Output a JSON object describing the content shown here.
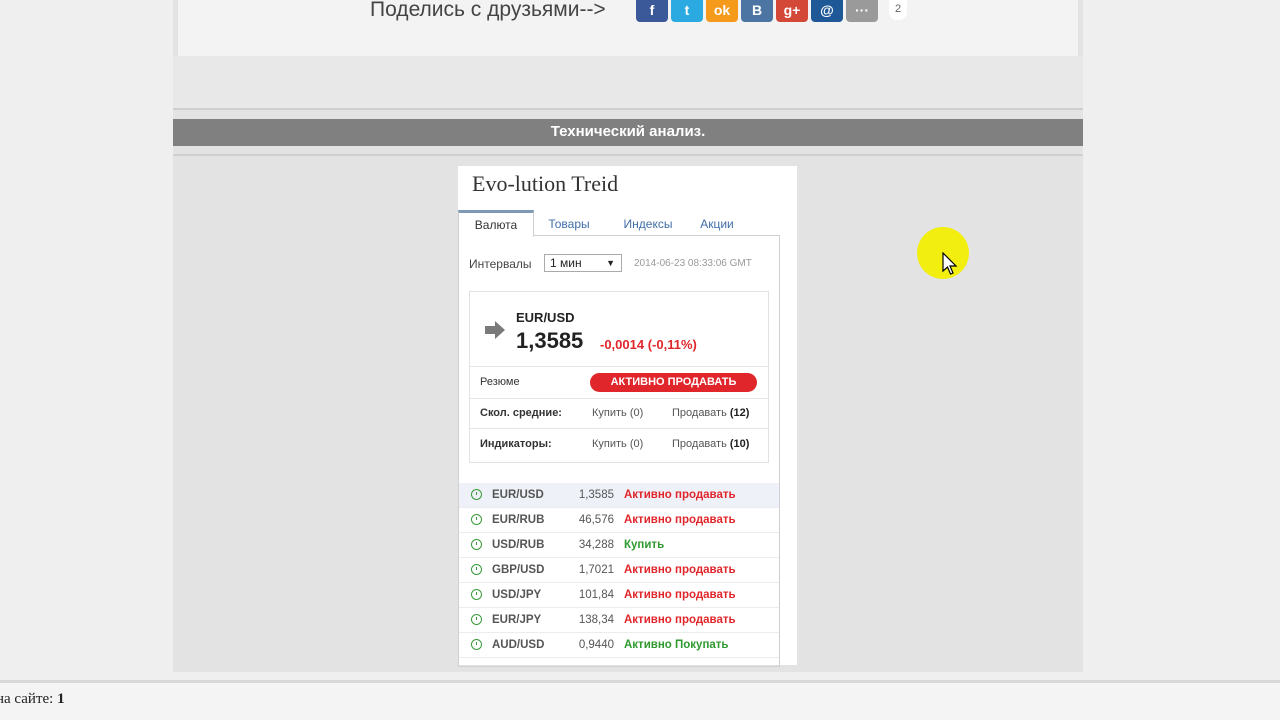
{
  "share": {
    "text": "Поделись с друзьями-->",
    "icons": [
      {
        "icon": "facebook-icon",
        "glyph": "f",
        "color": "#3b5998"
      },
      {
        "icon": "twitter-icon",
        "glyph": "t",
        "color": "#2ba9e1"
      },
      {
        "icon": "odnoklassniki-icon",
        "glyph": "ok",
        "color": "#f59a1a"
      },
      {
        "icon": "vkontakte-icon",
        "glyph": "B",
        "color": "#4c75a3"
      },
      {
        "icon": "google-plus-icon",
        "glyph": "g+",
        "color": "#d34836"
      },
      {
        "icon": "mail-ru-icon",
        "glyph": "@",
        "color": "#1e5896"
      },
      {
        "icon": "more-icon",
        "glyph": "···",
        "color": "#9a9a9a"
      }
    ],
    "count": "2"
  },
  "section": {
    "title": "Технический анализ."
  },
  "widget": {
    "title": "Evo-lution Treid",
    "tabs": [
      "Валюта",
      "Товары",
      "Индексы",
      "Акции"
    ],
    "interval_label": "Интервалы",
    "interval_value": "1 мин",
    "timestamp": "2014-06-23 08:33:06 GMT",
    "summary": {
      "pair": "EUR/USD",
      "price": "1,3585",
      "change": "-0,0014 (-0,11%)",
      "resume_label": "Резюме",
      "resume_badge": "АКТИВНО ПРОДАВАТЬ",
      "ma_label": "Скол. средние:",
      "ma_buy": "Купить (0)",
      "ma_sell_label": "Продавать",
      "ma_sell_count": "(12)",
      "ind_label": "Индикаторы:",
      "ind_buy": "Купить (0)",
      "ind_sell_label": "Продавать",
      "ind_sell_count": "(10)"
    },
    "pairs": [
      {
        "name": "EUR/USD",
        "value": "1,3585",
        "signal": "Активно продавать",
        "type": "sell"
      },
      {
        "name": "EUR/RUB",
        "value": "46,576",
        "signal": "Активно продавать",
        "type": "sell"
      },
      {
        "name": "USD/RUB",
        "value": "34,288",
        "signal": "Купить",
        "type": "buy"
      },
      {
        "name": "GBP/USD",
        "value": "1,7021",
        "signal": "Активно продавать",
        "type": "sell"
      },
      {
        "name": "USD/JPY",
        "value": "101,84",
        "signal": "Активно продавать",
        "type": "sell"
      },
      {
        "name": "EUR/JPY",
        "value": "138,34",
        "signal": "Активно продавать",
        "type": "sell"
      },
      {
        "name": "AUD/USD",
        "value": "0,9440",
        "signal": "Активно Покупать",
        "type": "buy"
      }
    ]
  },
  "footer": {
    "label": "на сайте:",
    "count": "1"
  },
  "colors": {
    "sell": "#e0262b",
    "buy": "#2f9a2f",
    "section_bar": "#808080",
    "cursor_halo": "#f1ee10"
  }
}
